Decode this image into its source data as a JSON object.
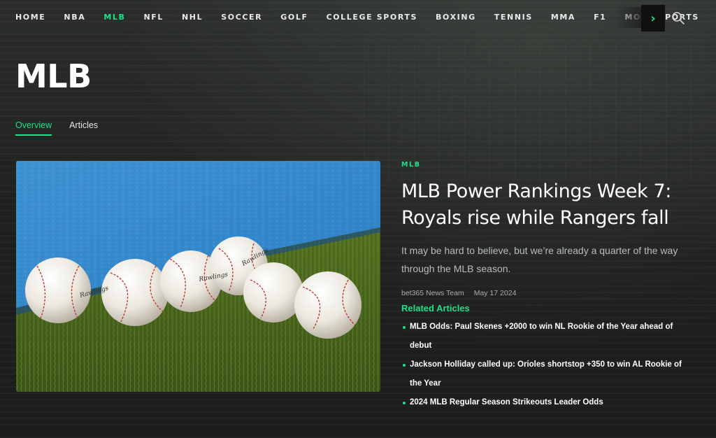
{
  "nav": {
    "items": [
      {
        "label": "HOME",
        "active": false
      },
      {
        "label": "NBA",
        "active": false
      },
      {
        "label": "MLB",
        "active": true
      },
      {
        "label": "NFL",
        "active": false
      },
      {
        "label": "NHL",
        "active": false
      },
      {
        "label": "SOCCER",
        "active": false
      },
      {
        "label": "GOLF",
        "active": false
      },
      {
        "label": "COLLEGE SPORTS",
        "active": false
      },
      {
        "label": "BOXING",
        "active": false
      },
      {
        "label": "TENNIS",
        "active": false
      },
      {
        "label": "MMA",
        "active": false
      },
      {
        "label": "F1",
        "active": false
      },
      {
        "label": "MORE SPORTS",
        "active": false
      }
    ],
    "next_icon": "chevron-right-icon",
    "search_icon": "search-icon"
  },
  "page": {
    "title": "MLB",
    "tabs": [
      {
        "label": "Overview",
        "active": true
      },
      {
        "label": "Articles",
        "active": false
      }
    ]
  },
  "featured": {
    "image_subject": "baseballs-on-grass",
    "category": "MLB",
    "headline": "MLB Power Rankings Week 7: Royals rise while Rangers fall",
    "excerpt": "It may be hard to believe, but we’re already a quarter of the way through the MLB season.",
    "author": "bet365 News Team",
    "date": "May 17 2024",
    "related_title": "Related Articles",
    "related": [
      "MLB Odds: Paul Skenes +2000 to win NL Rookie of the Year ahead of debut",
      "Jackson Holliday called up: Orioles shortstop +350 to win AL Rookie of the Year",
      "2024 MLB Regular Season Strikeouts Leader Odds"
    ]
  },
  "colors": {
    "accent": "#1ee08a",
    "background": "#1f211f",
    "text": "#ffffff",
    "muted": "#b9bdb9"
  }
}
